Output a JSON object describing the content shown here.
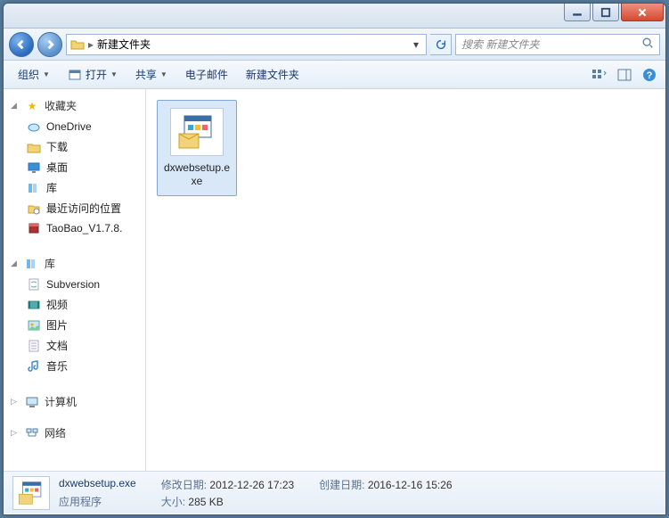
{
  "window": {
    "current_folder": "新建文件夹"
  },
  "search": {
    "placeholder": "搜索 新建文件夹"
  },
  "toolbar": {
    "organize": "组织",
    "open": "打开",
    "share": "共享",
    "email": "电子邮件",
    "new_folder": "新建文件夹"
  },
  "sidebar": {
    "favorites_label": "收藏夹",
    "favorites": [
      {
        "label": "OneDrive",
        "icon": "onedrive-icon"
      },
      {
        "label": "下载",
        "icon": "downloads-icon"
      },
      {
        "label": "桌面",
        "icon": "desktop-icon"
      },
      {
        "label": "库",
        "icon": "libraries-icon"
      },
      {
        "label": "最近访问的位置",
        "icon": "recent-icon"
      },
      {
        "label": "TaoBao_V1.7.8.",
        "icon": "archive-icon"
      }
    ],
    "libraries_label": "库",
    "libraries": [
      {
        "label": "Subversion",
        "icon": "subversion-icon"
      },
      {
        "label": "视频",
        "icon": "videos-icon"
      },
      {
        "label": "图片",
        "icon": "pictures-icon"
      },
      {
        "label": "文档",
        "icon": "documents-icon"
      },
      {
        "label": "音乐",
        "icon": "music-icon"
      }
    ],
    "computer_label": "计算机",
    "network_label": "网络"
  },
  "files": [
    {
      "name": "dxwebsetup.exe"
    }
  ],
  "details": {
    "filename": "dxwebsetup.exe",
    "type": "应用程序",
    "modified_label": "修改日期:",
    "modified": "2012-12-26 17:23",
    "size_label": "大小:",
    "size": "285 KB",
    "created_label": "创建日期:",
    "created": "2016-12-16 15:26"
  }
}
